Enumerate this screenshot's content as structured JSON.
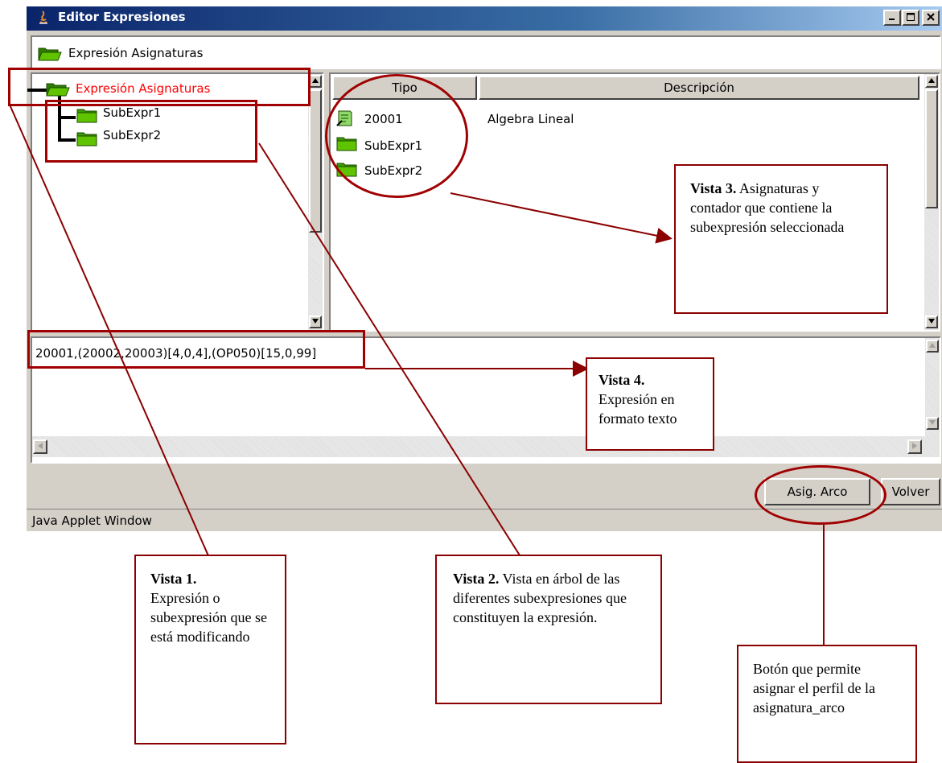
{
  "window": {
    "title": "Editor Expresiones",
    "status": "Java Applet Window",
    "controls": {
      "minimize": "_",
      "maximize": "□",
      "close": "X"
    }
  },
  "path_bar": {
    "label": "Expresión Asignaturas"
  },
  "tree": {
    "root": "Expresión Asignaturas",
    "children": [
      "SubExpr1",
      "SubExpr2"
    ]
  },
  "table": {
    "headers": {
      "tipo": "Tipo",
      "descripcion": "Descripción"
    },
    "rows": [
      {
        "tipo": "20001",
        "descripcion": "Algebra Lineal",
        "icon": "document-icon"
      },
      {
        "tipo": "SubExpr1",
        "descripcion": "",
        "icon": "folder-icon"
      },
      {
        "tipo": "SubExpr2",
        "descripcion": "",
        "icon": "folder-icon"
      }
    ]
  },
  "expression_text": "20001,(20002,20003)[4,0,4],(OP050)[15,0,99]",
  "buttons": {
    "asig_arco": "Asig. Arco",
    "volver": "Volver"
  },
  "annotations": {
    "vista1": {
      "title": "Vista 1.",
      "body": "Expresión o subexpresión que se está modificando"
    },
    "vista2": {
      "title": "Vista 2.",
      "body": "Vista en árbol de las diferentes subexpresiones que constituyen la expresión."
    },
    "vista3": {
      "title": "Vista 3.",
      "body": "Asignaturas y contador que contiene la subexpresión seleccionada"
    },
    "vista4": {
      "title": "Vista 4.",
      "body": "Expresión en formato texto"
    },
    "boton": {
      "body": "Botón que permite asignar el perfil de la asignatura_arco"
    }
  },
  "colors": {
    "title_bar": "#0a246a",
    "annotation": "#a00000",
    "tree_selected": "#ff0000",
    "folder": "#3c9a00"
  }
}
